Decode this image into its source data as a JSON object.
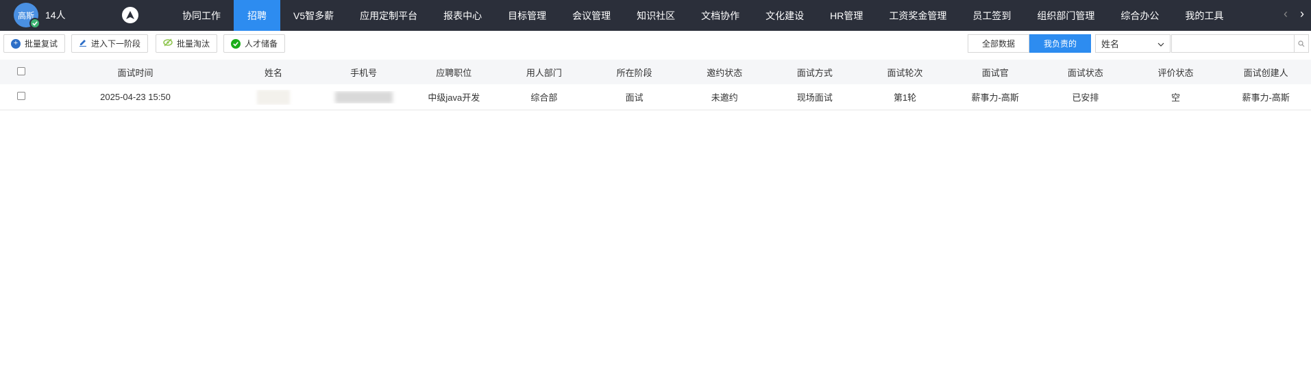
{
  "user": {
    "avatar_text": "高斯",
    "count": "14人"
  },
  "nav": {
    "items": [
      {
        "label": "协同工作"
      },
      {
        "label": "招聘",
        "active": true
      },
      {
        "label": "V5智多薪"
      },
      {
        "label": "应用定制平台"
      },
      {
        "label": "报表中心"
      },
      {
        "label": "目标管理"
      },
      {
        "label": "会议管理"
      },
      {
        "label": "知识社区"
      },
      {
        "label": "文档协作"
      },
      {
        "label": "文化建设"
      },
      {
        "label": "HR管理"
      },
      {
        "label": "工资奖金管理"
      },
      {
        "label": "员工签到"
      },
      {
        "label": "组织部门管理"
      },
      {
        "label": "综合办公"
      },
      {
        "label": "我的工具"
      }
    ],
    "prev": "‹",
    "next": "›"
  },
  "toolbar": {
    "batch_retest": "批量复试",
    "next_stage": "进入下一阶段",
    "batch_reject": "批量淘汰",
    "talent_pool": "人才储备",
    "all_data": "全部数据",
    "mine": "我负责的",
    "filter_select": "姓名",
    "search_placeholder": ""
  },
  "table": {
    "headers": [
      "面试时间",
      "姓名",
      "手机号",
      "应聘职位",
      "用人部门",
      "所在阶段",
      "邀约状态",
      "面试方式",
      "面试轮次",
      "面试官",
      "面试状态",
      "评价状态",
      "面试创建人"
    ],
    "rows": [
      {
        "interview_time": "2025-04-23 15:50",
        "position": "中级java开发",
        "department": "综合部",
        "stage": "面试",
        "invite_status": "未邀约",
        "method": "现场面试",
        "round": "第1轮",
        "interviewer": "薪事力-高斯",
        "interview_status": "已安排",
        "eval_status": "空",
        "creator": "薪事力-高斯"
      }
    ]
  },
  "colors": {
    "nav_bg": "#2b2f3a",
    "accent": "#2d8cf0"
  }
}
